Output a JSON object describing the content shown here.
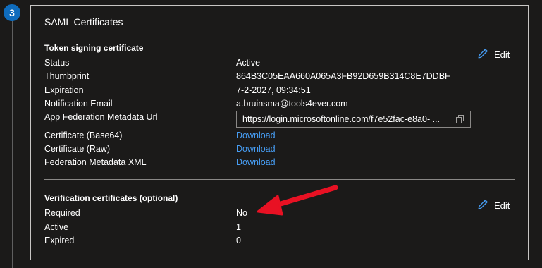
{
  "step": {
    "number": "3"
  },
  "card": {
    "title": "SAML Certificates"
  },
  "token_signing": {
    "title": "Token signing certificate",
    "edit_label": "Edit",
    "rows": [
      {
        "label": "Status",
        "value": "Active"
      },
      {
        "label": "Thumbprint",
        "value": "864B3C05EAA660A065A3FB92D659B314C8E7DDBF"
      },
      {
        "label": "Expiration",
        "value": "7-2-2027, 09:34:51"
      },
      {
        "label": "Notification Email",
        "value": "a.bruinsma@tools4ever.com"
      }
    ],
    "metadata_url": {
      "label": "App Federation Metadata Url",
      "value": "https://login.microsoftonline.com/f7e52fac-e8a0- ..."
    },
    "downloads": [
      {
        "label": "Certificate (Base64)",
        "link": "Download"
      },
      {
        "label": "Certificate (Raw)",
        "link": "Download"
      },
      {
        "label": "Federation Metadata XML",
        "link": "Download"
      }
    ]
  },
  "verification": {
    "title": "Verification certificates (optional)",
    "edit_label": "Edit",
    "rows": [
      {
        "label": "Required",
        "value": "No"
      },
      {
        "label": "Active",
        "value": "1"
      },
      {
        "label": "Expired",
        "value": "0"
      }
    ]
  },
  "colors": {
    "background": "#1b1a19",
    "accent": "#0f6cbd",
    "link": "#479ef5",
    "annotation_arrow": "#e81123"
  },
  "icons": {
    "edit": "pencil-icon",
    "copy": "copy-icon",
    "annotation": "red-arrow"
  }
}
